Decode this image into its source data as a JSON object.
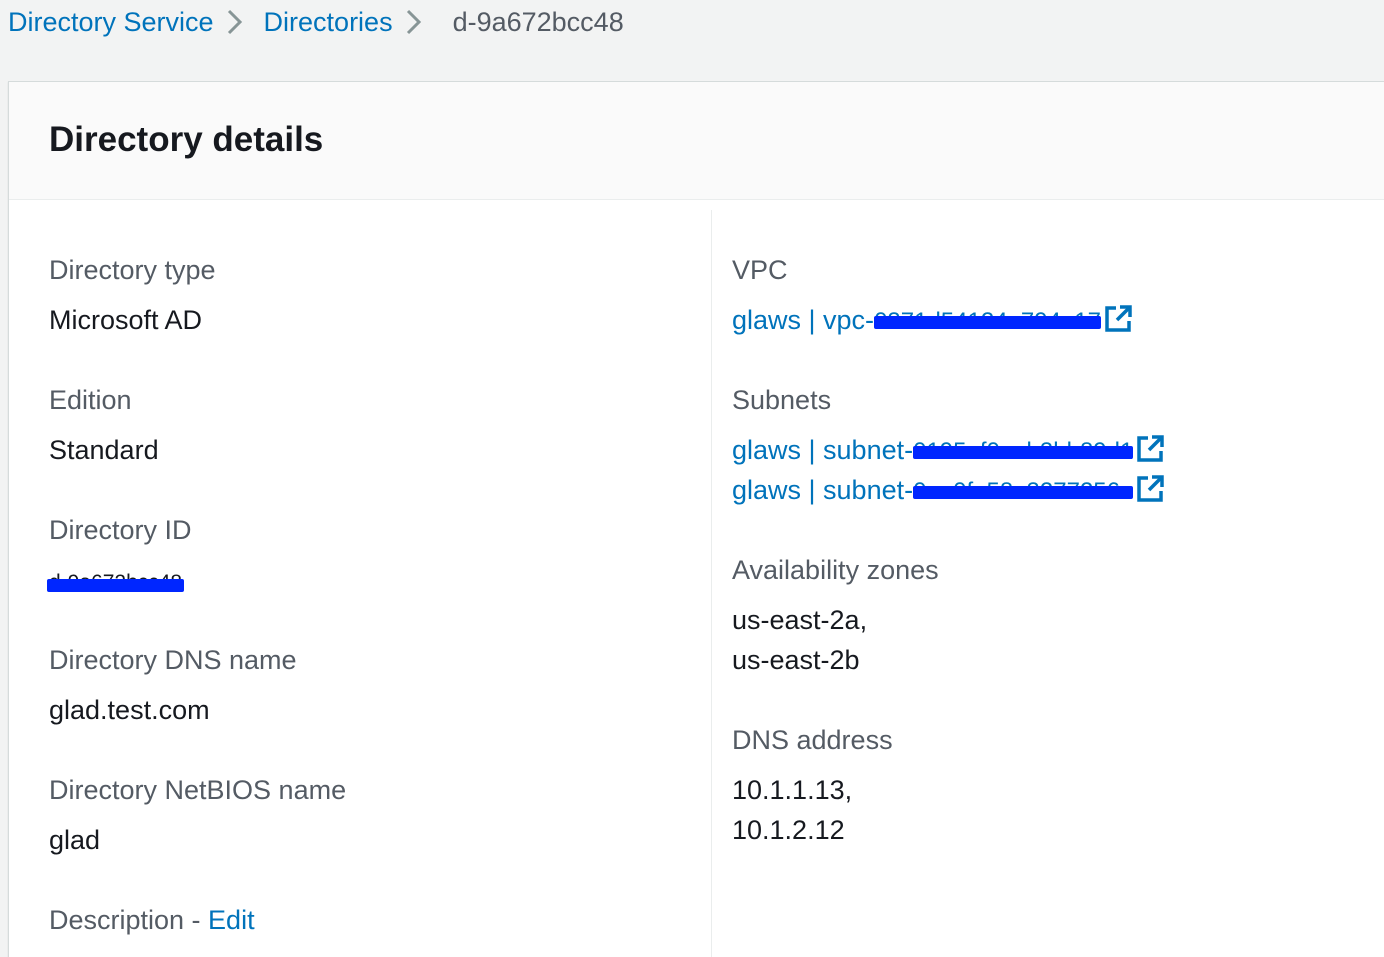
{
  "breadcrumb": {
    "items": [
      "Directory Service",
      "Directories"
    ],
    "current": "d-9a672bcc48"
  },
  "panel": {
    "title": "Directory details"
  },
  "left": {
    "directory_type": {
      "label": "Directory type",
      "value": "Microsoft AD"
    },
    "edition": {
      "label": "Edition",
      "value": "Standard"
    },
    "directory_id": {
      "label": "Directory ID",
      "value": "d-9a672bcc48"
    },
    "dns_name": {
      "label": "Directory DNS name",
      "value": "glad.test.com"
    },
    "netbios_name": {
      "label": "Directory NetBIOS name",
      "value": "glad"
    },
    "description": {
      "label": "Description - ",
      "edit": "Edit"
    }
  },
  "right": {
    "vpc": {
      "label": "VPC",
      "prefix": "glaws | vpc-",
      "redacted": "0371d54124e794e17"
    },
    "subnets": {
      "label": "Subnets",
      "items": [
        {
          "prefix": "glaws | subnet-",
          "redacted": "0195af0aab3bb89d1"
        },
        {
          "prefix": "glaws | subnet-",
          "redacted": "0ee0fe58e3277256e"
        }
      ]
    },
    "availability_zones": {
      "label": "Availability zones",
      "values": [
        "us-east-2a,",
        "us-east-2b"
      ]
    },
    "dns_address": {
      "label": "DNS address",
      "values": [
        "10.1.1.13,",
        "10.1.2.12"
      ]
    }
  },
  "icons": {
    "breadcrumb_separator": "chevron-right-icon",
    "external_link": "external-link-icon"
  },
  "colors": {
    "link": "#0073bb",
    "redaction": "#0026ff",
    "label": "#545b64",
    "text": "#16191f",
    "background": "#f2f3f3"
  }
}
